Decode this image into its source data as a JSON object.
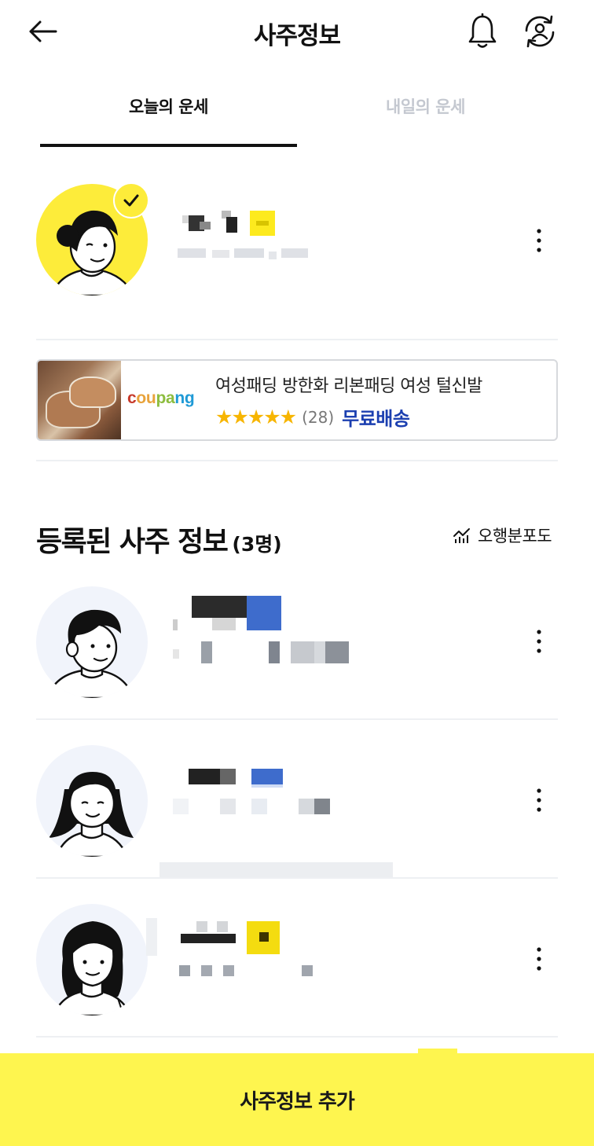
{
  "header": {
    "title": "사주정보"
  },
  "tabs": [
    {
      "label": "오늘의 운세"
    },
    {
      "label": "내일의 운세"
    }
  ],
  "ad": {
    "brand": "coupang",
    "brand_colors": [
      "#c73a2b",
      "#e8a33b",
      "#8dbd3f",
      "#1f9ad6"
    ],
    "title": "여성패딩 방한화 리본패딩 여성 털신발",
    "stars": "★★★★★",
    "rating": 4.5,
    "review_count": "(28)",
    "shipping": "무료배송"
  },
  "section": {
    "title": "등록된 사주 정보",
    "count": "(3명)",
    "distribution_link": "오행분포도"
  },
  "bottom": {
    "add_button": "사주정보 추가"
  },
  "colors": {
    "accent_yellow": "#fef54f",
    "avatar_yellow": "#fdec3a",
    "link_blue": "#1b3fb0",
    "star": "#f7b500",
    "inactive_tab": "#c4c8d0"
  }
}
